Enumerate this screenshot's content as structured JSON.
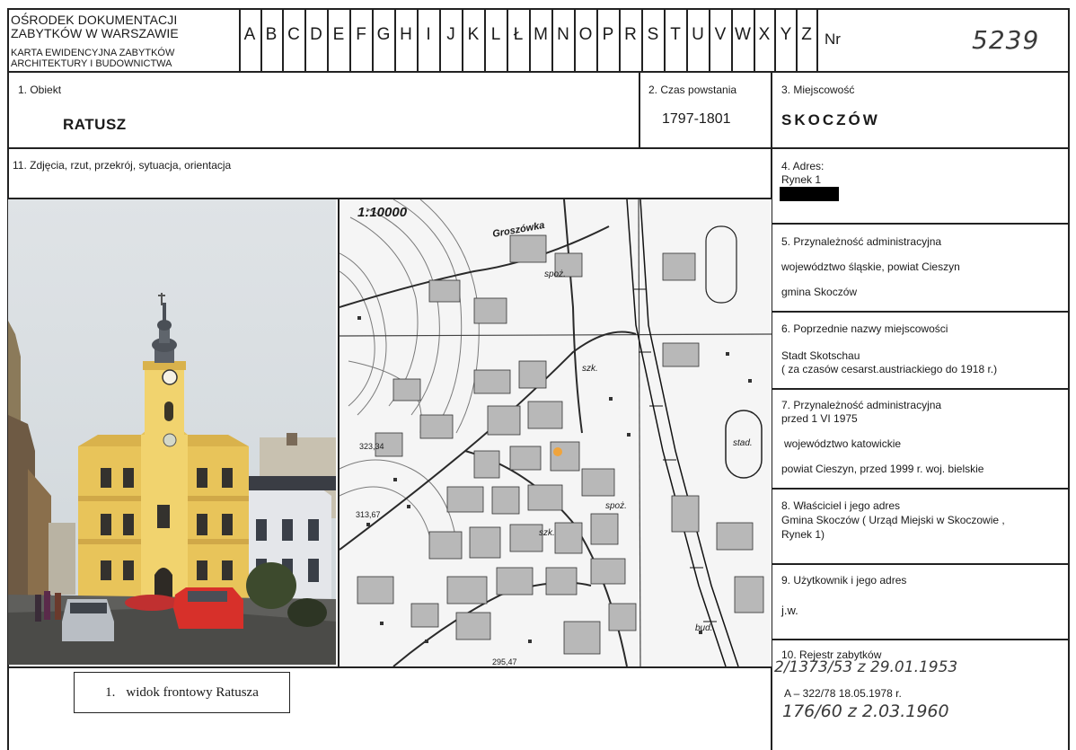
{
  "header": {
    "institution_line1": "OŚRODEK DOKUMENTACJI",
    "institution_line2": "ZABYTKÓW W WARSZAWIE",
    "card_line1": "KARTA EWIDENCYJNA ZABYTKÓW",
    "card_line2": "ARCHITEKTURY I BUDOWNICTWA",
    "letters": [
      "A",
      "B",
      "C",
      "D",
      "E",
      "F",
      "G",
      "H",
      "I",
      "J",
      "K",
      "L",
      "Ł",
      "M",
      "N",
      "O",
      "P",
      "R",
      "S",
      "T",
      "U",
      "V",
      "W",
      "X",
      "Y",
      "Z"
    ],
    "nr_label": "Nr",
    "nr_value": "5239"
  },
  "object": {
    "label": "1. Obiekt",
    "value": "RATUSZ"
  },
  "date": {
    "label": "2. Czas powstania",
    "value": "1797-1801"
  },
  "locality": {
    "label": "3. Miejscowość",
    "value": "SKOCZÓW"
  },
  "photos": {
    "label": "11. Zdjęcia, rzut, przekrój, sytuacja, orientacja"
  },
  "address": {
    "label": "4. Adres:",
    "value": "Rynek 1"
  },
  "admin": {
    "label": "5. Przynależność administracyjna",
    "line1": "województwo śląskie,  powiat Cieszyn",
    "line2": "gmina  Skoczów"
  },
  "previous_names": {
    "label": "6. Poprzednie nazwy miejscowości",
    "line1": "Stadt Skotschau",
    "line2": "( za czasów cesarst.austriackiego do 1918 r.)"
  },
  "admin_1975": {
    "label": "7. Przynależność administracyjna",
    "sublabel": "przed 1 VI 1975",
    "line1": "województwo  katowickie",
    "line2": "powiat Cieszyn, przed 1999 r. woj. bielskie"
  },
  "owner": {
    "label": "8. Właściciel i jego adres",
    "line1": "Gmina Skoczów ( Urząd Miejski w Skoczowie ,",
    "line2": "Rynek 1)"
  },
  "user": {
    "label": "9. Użytkownik i jego adres",
    "value": "j.w."
  },
  "register": {
    "label": "10. Rejestr zabytków",
    "entry1": "2/1373/53 z 29.01.1953",
    "entry2": "A – 322/78  18.05.1978 r.",
    "entry3": "176/60 z 2.03.1960"
  },
  "map": {
    "scale": "1:10000",
    "place_name": "Groszówka",
    "spot1": "323,34",
    "spot2": "313,67",
    "spot3": "295,47",
    "stad": "stad.",
    "bud": "bud.",
    "szk1": "szk.",
    "szk2": "szk.",
    "spoz1": "spoż.",
    "spoz2": "spoż."
  },
  "caption": {
    "number": "1.",
    "text": "widok frontowy Ratusza"
  }
}
